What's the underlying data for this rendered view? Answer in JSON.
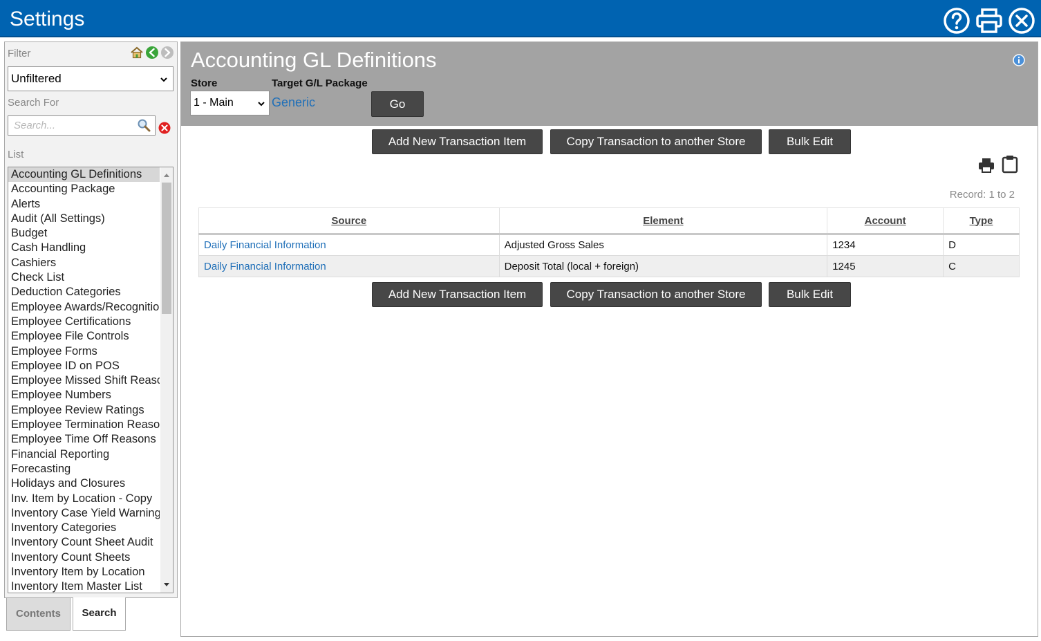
{
  "app": {
    "title": "Settings"
  },
  "left": {
    "filter_label": "Filter",
    "filter_value": "Unfiltered",
    "search_label": "Search For",
    "search_placeholder": "Search...",
    "list_label": "List",
    "items": [
      "Accounting GL Definitions",
      "Accounting Package",
      "Alerts",
      "Audit (All Settings)",
      "Budget",
      "Cash Handling",
      "Cashiers",
      "Check List",
      "Deduction Categories",
      "Employee Awards/Recognition",
      "Employee Certifications",
      "Employee File Controls",
      "Employee Forms",
      "Employee ID on POS",
      "Employee Missed Shift Reasons",
      "Employee Numbers",
      "Employee Review Ratings",
      "Employee Termination Reasons",
      "Employee Time Off Reasons",
      "Financial Reporting",
      "Forecasting",
      "Holidays and Closures",
      "Inv. Item by Location - Copy",
      "Inventory Case Yield Warning",
      "Inventory Categories",
      "Inventory Count Sheet Audit",
      "Inventory Count Sheets",
      "Inventory Item by Location",
      "Inventory Item Master List"
    ],
    "tabs": {
      "contents": "Contents",
      "search": "Search"
    }
  },
  "main": {
    "title": "Accounting GL Definitions",
    "store_label": "Store",
    "store_value": "1 - Main",
    "package_label": "Target G/L Package",
    "package_value": "Generic",
    "go_label": "Go",
    "buttons": {
      "add": "Add New Transaction Item",
      "copy": "Copy Transaction to another Store",
      "bulk": "Bulk Edit"
    },
    "record_text": "Record: 1 to 2",
    "table": {
      "headers": [
        "Source",
        "Element",
        "Account",
        "Type"
      ],
      "rows": [
        [
          "Daily Financial Information",
          "Adjusted Gross Sales",
          "1234",
          "D"
        ],
        [
          "Daily Financial Information",
          "Deposit Total (local + foreign)",
          "1245",
          "C"
        ]
      ]
    }
  },
  "colors": {
    "titlebar": "#0063b1",
    "header": "#a3a3a3",
    "button": "#474747",
    "link": "#1f6fb8"
  }
}
